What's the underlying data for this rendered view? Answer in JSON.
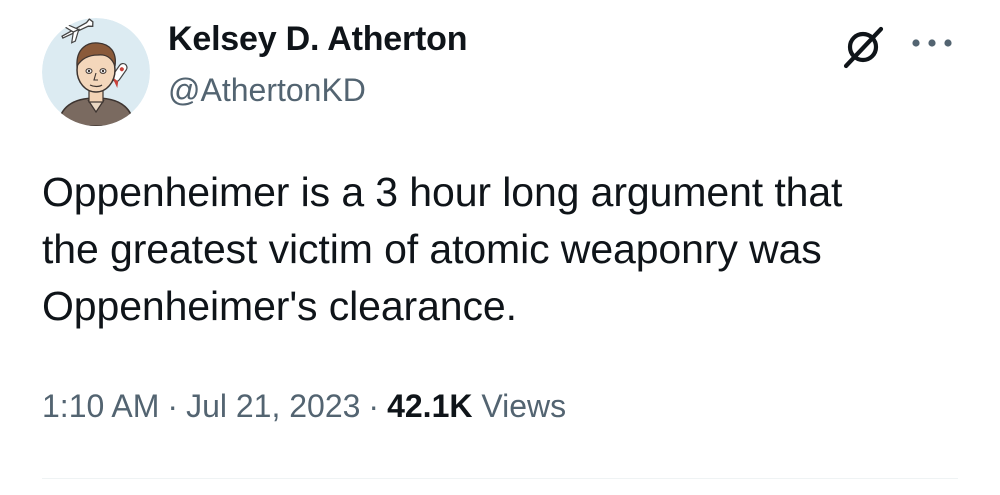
{
  "author": {
    "display_name": "Kelsey D. Atherton",
    "handle": "@AthertonKD"
  },
  "tweet": {
    "lines": [
      "Oppenheimer is a 3 hour long argument that",
      "the greatest victim of atomic weaponry was",
      "Oppenheimer's clearance."
    ]
  },
  "meta": {
    "time": "1:10 AM",
    "separator": "·",
    "date": "Jul 21, 2023",
    "views_count": "42.1K",
    "views_label": "Views"
  },
  "icons": {
    "badge": "slashed-circle-icon",
    "more": "more-options-icon"
  },
  "colors": {
    "text_primary": "#0f1419",
    "text_secondary": "#536471",
    "divider": "#eff3f4"
  }
}
